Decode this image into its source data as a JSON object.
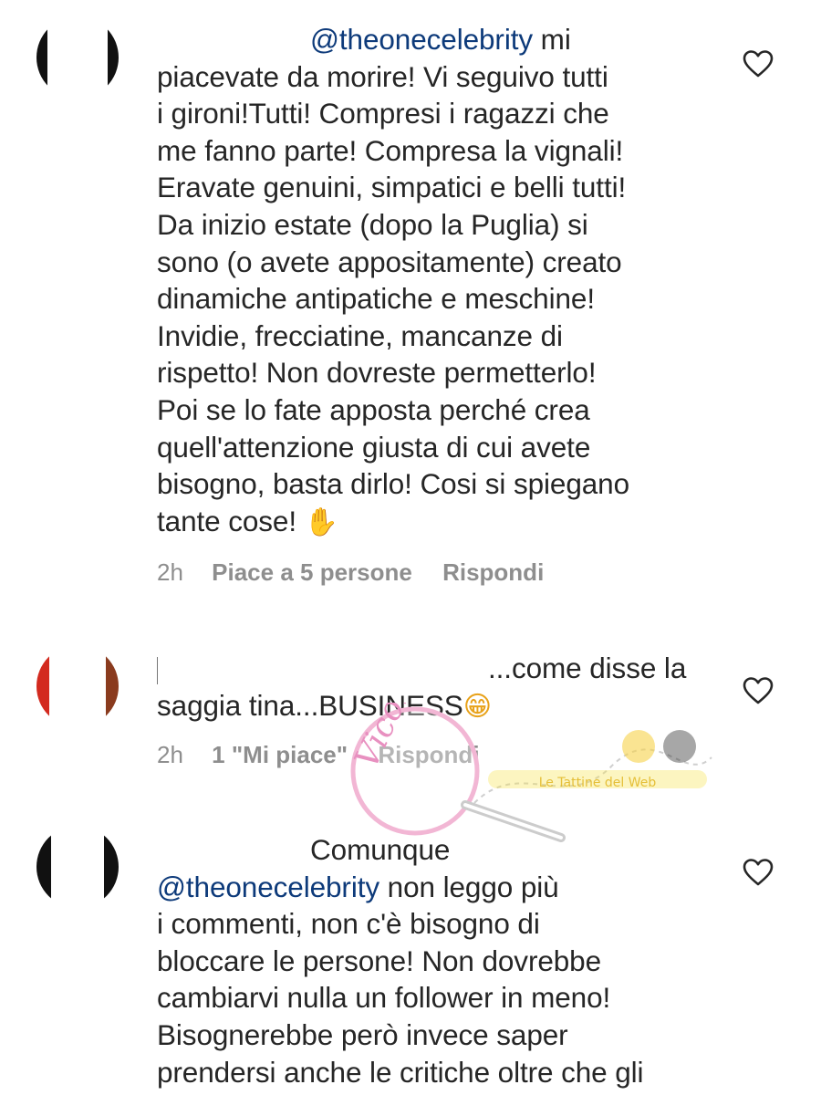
{
  "comments": [
    {
      "mention": "@theonecelebrity",
      "lines": [
        " mi",
        "piacevate da morire! Vi seguivo tutti",
        "i gironi!Tutti! Compresi i ragazzi che",
        "me fanno parte! Compresa la vignali!",
        "Eravate genuini, simpatici e belli tutti!",
        "Da inizio estate (dopo la Puglia) si",
        "sono (o avete appositamente) creato",
        "dinamiche antipatiche e meschine!",
        "Invidie, frecciatine, mancanze di",
        "rispetto! Non dovreste permetterlo!",
        "Poi se lo fate apposta perché crea",
        "quell'attenzione giusta di cui avete",
        "bisogno, basta dirlo! Cosi si spiegano",
        "tante cose! "
      ],
      "emoji": "✋",
      "time": "2h",
      "likes": "Piace a 5 persone",
      "reply": "Rispondi"
    },
    {
      "lines": [
        "...come disse la",
        "saggia tina...BUSINESS"
      ],
      "emoji": "😁",
      "time": "2h",
      "likes": "1 \"Mi piace\"",
      "reply": "Rispondi"
    },
    {
      "first_line": "Comunque",
      "mention": "@theonecelebrity",
      "lines": [
        " non leggo più",
        "i commenti, non c'è bisogno di",
        "bloccare le persone! Non dovrebbe",
        "cambiarvi nulla un follower in meno!",
        "Bisognerebbe però invece saper",
        "prendersi anche le critiche oltre che gli"
      ]
    }
  ],
  "watermark": {
    "left": "Vicolo delle News",
    "right": "Le Tattine del Web"
  },
  "icons": {
    "like": "heart-outline-icon"
  },
  "colors": {
    "mention": "#0d3a7a",
    "meta": "#8e8e8e",
    "text": "#262626"
  }
}
